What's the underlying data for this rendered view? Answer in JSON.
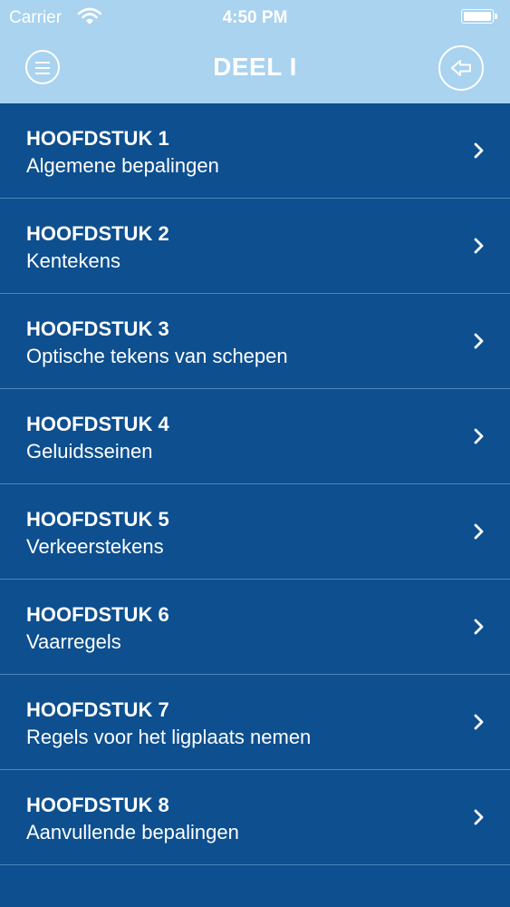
{
  "status_bar": {
    "carrier": "Carrier",
    "time": "4:50 PM",
    "wifi_icon": "wifi-icon",
    "battery_icon": "battery-icon",
    "battery_level": 1.0
  },
  "nav_bar": {
    "title": "DEEL I",
    "menu_icon": "menu-icon",
    "back_icon": "back-arrow-icon"
  },
  "chapters": [
    {
      "title": "HOOFDSTUK 1",
      "subtitle": "Algemene bepalingen"
    },
    {
      "title": "HOOFDSTUK 2",
      "subtitle": "Kentekens"
    },
    {
      "title": "HOOFDSTUK 3",
      "subtitle": "Optische tekens van schepen"
    },
    {
      "title": "HOOFDSTUK 4",
      "subtitle": "Geluidsseinen"
    },
    {
      "title": "HOOFDSTUK 5",
      "subtitle": "Verkeerstekens"
    },
    {
      "title": "HOOFDSTUK 6",
      "subtitle": "Vaarregels"
    },
    {
      "title": "HOOFDSTUK 7",
      "subtitle": "Regels voor het ligplaats nemen"
    },
    {
      "title": "HOOFDSTUK 8",
      "subtitle": "Aanvullende bepalingen"
    }
  ],
  "colors": {
    "header_background": "#a9d3ef",
    "list_background": "#0d4f8f",
    "divider": "#4f86bb",
    "text": "#ffffff"
  }
}
